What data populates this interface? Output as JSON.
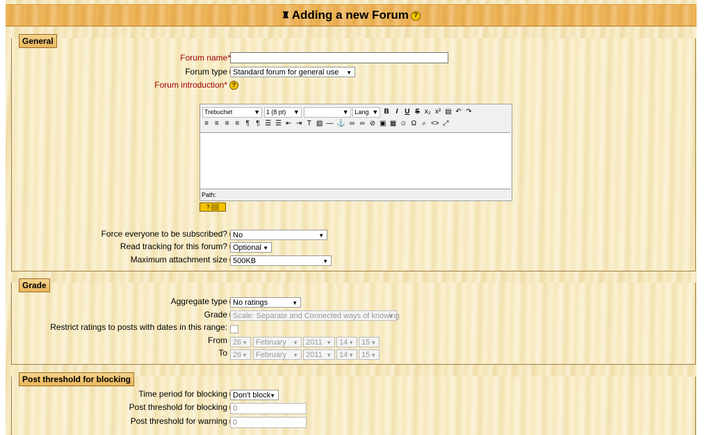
{
  "header": {
    "title": "Adding a new Forum",
    "help_glyph": "?"
  },
  "general": {
    "legend": "General",
    "forum_name": {
      "label": "Forum name*",
      "value": ""
    },
    "forum_type": {
      "label": "Forum type",
      "value": "Standard forum for general use"
    },
    "forum_intro": {
      "label": "Forum introduction*"
    },
    "editor": {
      "font": "Trebuchet",
      "size": "1 (8 pt)",
      "format": "",
      "lang": "Lang",
      "path_label": "Path:"
    },
    "force_subscribe": {
      "label": "Force everyone to be subscribed?",
      "value": "No"
    },
    "read_tracking": {
      "label": "Read tracking for this forum?",
      "value": "Optional"
    },
    "max_attach": {
      "label": "Maximum attachment size",
      "value": "500KB"
    }
  },
  "grade": {
    "legend": "Grade",
    "aggregate": {
      "label": "Aggregate type",
      "value": "No ratings"
    },
    "grade": {
      "label": "Grade",
      "value": "Scale: Separate and Connected ways of knowing"
    },
    "restrict": {
      "label": "Restrict ratings to posts with dates in this range:"
    },
    "from": {
      "label": "From",
      "day": "26",
      "month": "February",
      "year": "2011",
      "hour": "14",
      "minute": "15"
    },
    "to": {
      "label": "To",
      "day": "26",
      "month": "February",
      "year": "2011",
      "hour": "14",
      "minute": "15"
    }
  },
  "blocking": {
    "legend": "Post threshold for blocking",
    "period": {
      "label": "Time period for blocking",
      "value": "Don't block"
    },
    "threshold_block": {
      "label": "Post threshold for blocking",
      "value": "0"
    },
    "threshold_warn": {
      "label": "Post threshold for warning",
      "value": "0"
    }
  },
  "icons": {
    "logo": "moodle-logo-icon",
    "help": "help-icon"
  }
}
